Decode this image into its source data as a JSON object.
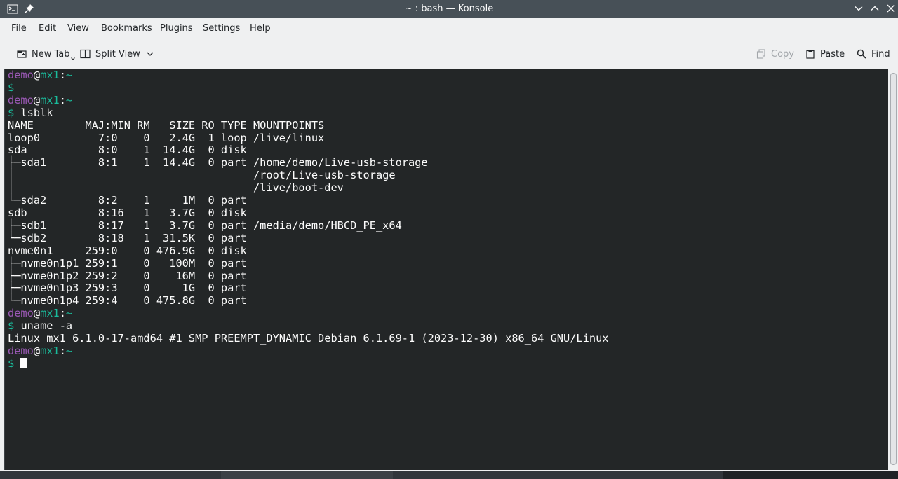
{
  "window": {
    "title": "~ : bash — Konsole"
  },
  "menubar": {
    "items": [
      "File",
      "Edit",
      "View",
      "Bookmarks",
      "Plugins",
      "Settings",
      "Help"
    ]
  },
  "toolbar": {
    "new_tab": "New Tab",
    "split_view": "Split View",
    "copy": "Copy",
    "paste": "Paste",
    "find": "Find"
  },
  "terminal": {
    "user": "demo",
    "host": "mx1",
    "path": "~",
    "prompt_symbol": "$",
    "cmd_lsblk": "lsblk",
    "lsblk_output": [
      "NAME        MAJ:MIN RM   SIZE RO TYPE MOUNTPOINTS",
      "loop0         7:0    0   2.4G  1 loop /live/linux",
      "sda           8:0    1  14.4G  0 disk",
      "├─sda1        8:1    1  14.4G  0 part /home/demo/Live-usb-storage",
      "│                                     /root/Live-usb-storage",
      "│                                     /live/boot-dev",
      "└─sda2        8:2    1     1M  0 part",
      "sdb           8:16   1   3.7G  0 disk",
      "├─sdb1        8:17   1   3.7G  0 part /media/demo/HBCD_PE_x64",
      "└─sdb2        8:18   1  31.5K  0 part",
      "nvme0n1     259:0    0 476.9G  0 disk",
      "├─nvme0n1p1 259:1    0   100M  0 part",
      "├─nvme0n1p2 259:2    0    16M  0 part",
      "├─nvme0n1p3 259:3    0     1G  0 part",
      "└─nvme0n1p4 259:4    0 475.8G  0 part"
    ],
    "cmd_uname": "uname -a",
    "uname_output": "Linux mx1 6.1.0-17-amd64 #1 SMP PREEMPT_DYNAMIC Debian 6.1.69-1 (2023-12-30) x86_64 GNU/Linux"
  }
}
